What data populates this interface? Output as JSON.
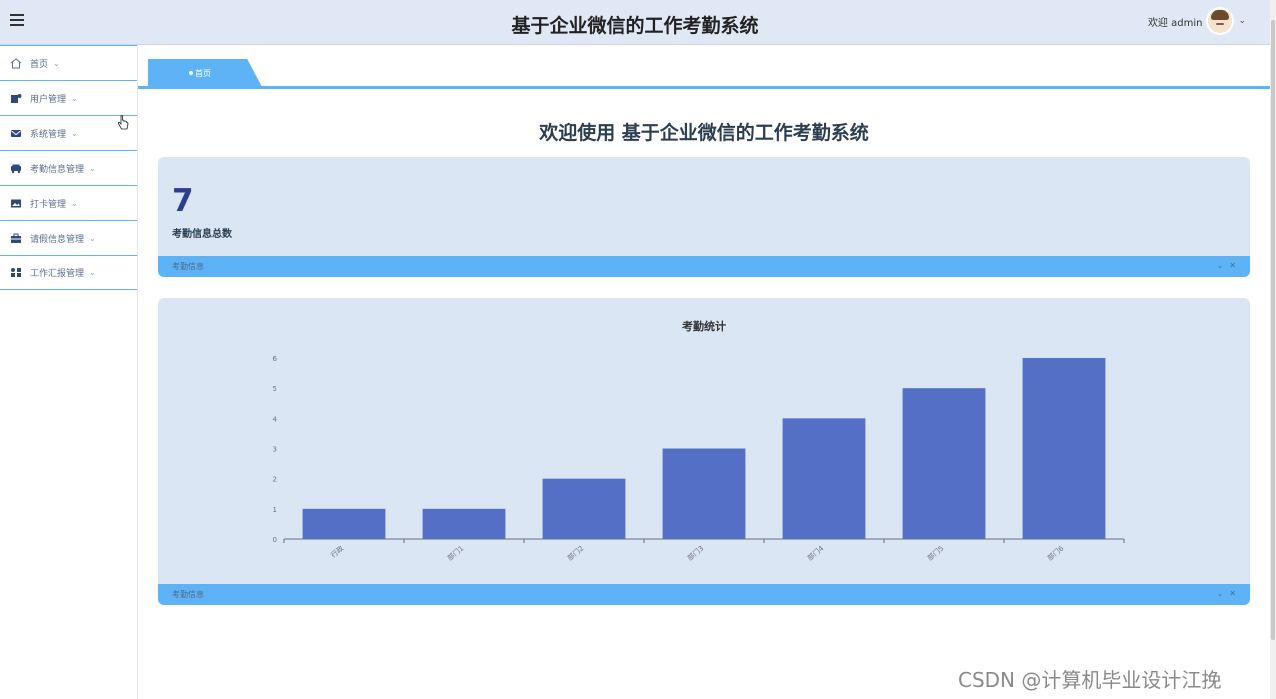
{
  "header": {
    "title": "基于企业微信的工作考勤系统",
    "greeting": "欢迎 admin"
  },
  "sidebar": {
    "items": [
      {
        "label": "首页",
        "icon": "home-icon"
      },
      {
        "label": "用户管理",
        "icon": "user-icon"
      },
      {
        "label": "系统管理",
        "icon": "envelope-icon"
      },
      {
        "label": "考勤信息管理",
        "icon": "car-icon"
      },
      {
        "label": "打卡管理",
        "icon": "image-icon"
      },
      {
        "label": "请假信息管理",
        "icon": "briefcase-icon"
      },
      {
        "label": "工作汇报管理",
        "icon": "grid-icon"
      }
    ]
  },
  "tabs": [
    {
      "label": "首页"
    }
  ],
  "main": {
    "welcome": "欢迎使用 基于企业微信的工作考勤系统",
    "stat": {
      "value": "7",
      "label": "考勤信息总数",
      "footer": "考勤信息"
    },
    "chart_card": {
      "footer": "考勤信息"
    }
  },
  "colors": {
    "accent": "#5eb3f6",
    "bar": "#5470c6",
    "card": "#dbe6f4",
    "stat_value": "#2b3e8f"
  },
  "chart_data": {
    "type": "bar",
    "title": "考勤统计",
    "categories": [
      "行政",
      "部门1",
      "部门2",
      "部门3",
      "部门4",
      "部门5",
      "部门6"
    ],
    "values": [
      1,
      1,
      2,
      3,
      4,
      5,
      6
    ],
    "ylim": [
      0,
      6
    ],
    "yticks": [
      0,
      1,
      2,
      3,
      4,
      5,
      6
    ],
    "grid": false,
    "legend": "none"
  },
  "watermark": "CSDN @计算机毕业设计江挽"
}
